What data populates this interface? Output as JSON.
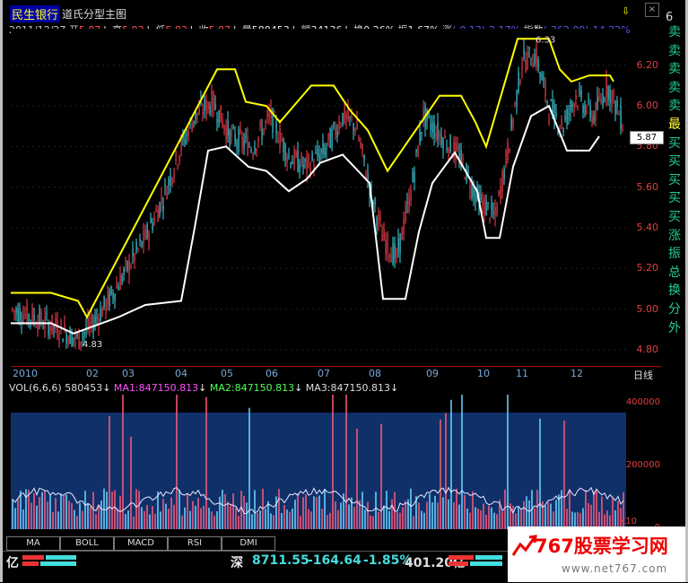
{
  "window": {
    "stock_name": "民生银行",
    "chart_title": "道氏分型主图",
    "panel_indicator": "6",
    "close_label": "×",
    "arrow_icon": "⇩"
  },
  "info_line": {
    "date": "2011/12/27",
    "open_label": "开",
    "open": "5.87",
    "high_label": "高",
    "high": "5.93",
    "low_label": "低",
    "low": "5.83",
    "close_label": "收",
    "close": "5.87",
    "vol_label": "量",
    "vol": "580453",
    "amt_label": "额",
    "amt": "34136",
    "turn_label": "换",
    "turn": "0.26%",
    "amp_label": "振",
    "amp": "1.67%",
    "chg_label": "涨",
    "chg": "(-0.13)-2.17%",
    "idx_label": "指数",
    "idx": "(-362.09)-14.32%"
  },
  "side_panel": [
    "卖",
    "卖",
    "卖",
    "卖",
    "卖",
    "最",
    "买",
    "买",
    "买",
    "买",
    "买",
    "涨",
    "振",
    "总",
    "换",
    "分",
    "外"
  ],
  "price_axis": {
    "ticks": [
      {
        "label": "6.20",
        "value": 6.2
      },
      {
        "label": "6.00",
        "value": 6.0
      },
      {
        "label": "5.80",
        "value": 5.8
      },
      {
        "label": "5.60",
        "value": 5.6
      },
      {
        "label": "5.40",
        "value": 5.4
      },
      {
        "label": "5.20",
        "value": 5.2
      },
      {
        "label": "5.00",
        "value": 5.0
      },
      {
        "label": "4.80",
        "value": 4.8
      }
    ],
    "current_price": "5.87",
    "max_annotation": "6.33",
    "min_annotation": "4.83",
    "range": [
      4.72,
      6.38
    ]
  },
  "time_axis": {
    "ticks": [
      "2010",
      "02",
      "03",
      "04",
      "05",
      "06",
      "07",
      "08",
      "09",
      "10",
      "11",
      "12"
    ],
    "period": "日线"
  },
  "vol_legend": {
    "name": "VOL(6,6,6)",
    "value": "580453",
    "ma1": "MA1:847150.813",
    "ma2": "MA2:847150.813",
    "ma3": "MA3:847150.813"
  },
  "vol_axis": {
    "ticks": [
      {
        "label": "400000",
        "value": 400000
      },
      {
        "label": "200000",
        "value": 200000
      },
      {
        "label": "0",
        "value": 0
      }
    ],
    "unit": "X10"
  },
  "tabs": [
    "MA",
    "BOLL",
    "MACD",
    "RSI",
    "DMI"
  ],
  "status_bar": {
    "left_unit": "亿",
    "market_label": "深",
    "index_value": "8711.55",
    "index_change": "-164.64",
    "index_pct": "-1.85%",
    "turnover": "401.20亿"
  },
  "ad": {
    "title": "767股票学习网",
    "url": "www.net767.com"
  },
  "colors": {
    "up": "#ff4050",
    "down": "#40d8e8",
    "fractal_high": "#ffff00",
    "fractal_low": "#ffffff",
    "volume_bg": "#10306a"
  }
}
